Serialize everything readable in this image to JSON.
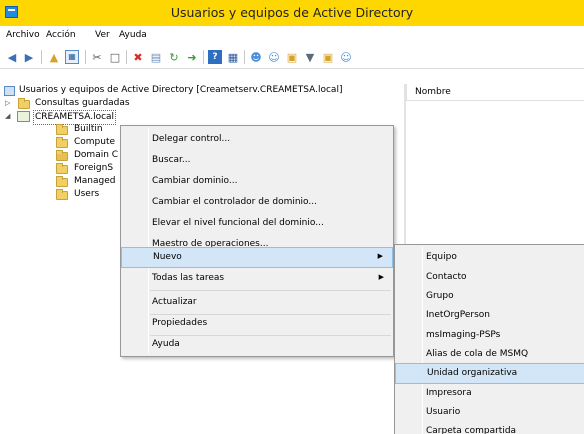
{
  "window": {
    "title": "Usuarios y equipos de Active Directory"
  },
  "menubar": [
    "Archivo",
    "Acción",
    "Ver",
    "Ayuda"
  ],
  "toolbar": {
    "icons": [
      "back-icon",
      "forward-icon",
      "up-folder-icon",
      "console-tree-icon",
      "cut-icon",
      "copy-icon",
      "delete-icon",
      "properties-icon",
      "refresh-icon",
      "export-icon",
      "help-icon",
      "view-icon",
      "add-user-icon",
      "add-group-icon",
      "add-ou-icon",
      "filter-icon",
      "find-icon",
      "group-icon"
    ]
  },
  "tree": {
    "root": "Usuarios y equipos de Active Directory [Creametserv.CREAMETSA.local]",
    "saved_queries": "Consultas guardadas",
    "domain": "CREAMETSA.local",
    "children": [
      "Builtin",
      "Compute",
      "Domain C",
      "ForeignS",
      "Managed",
      "Users"
    ]
  },
  "list": {
    "column_name": "Nombre"
  },
  "context_menu": {
    "items": [
      "Delegar control...",
      "Buscar...",
      "Cambiar dominio...",
      "Cambiar el controlador de dominio...",
      "Elevar el nivel funcional del dominio...",
      "Maestro de operaciones...",
      "Nuevo",
      "Todas las tareas",
      "Actualizar",
      "Propiedades",
      "Ayuda"
    ]
  },
  "submenu": {
    "items": [
      "Equipo",
      "Contacto",
      "Grupo",
      "InetOrgPerson",
      "msImaging-PSPs",
      "Alias de cola de MSMQ",
      "Unidad organizativa",
      "Impresora",
      "Usuario",
      "Carpeta compartida"
    ]
  },
  "colors": {
    "titlebar": "#ffd700",
    "highlight": "#d2e6f7",
    "highlight_border": "#8fc0ea",
    "folder": "#f2cf63"
  }
}
